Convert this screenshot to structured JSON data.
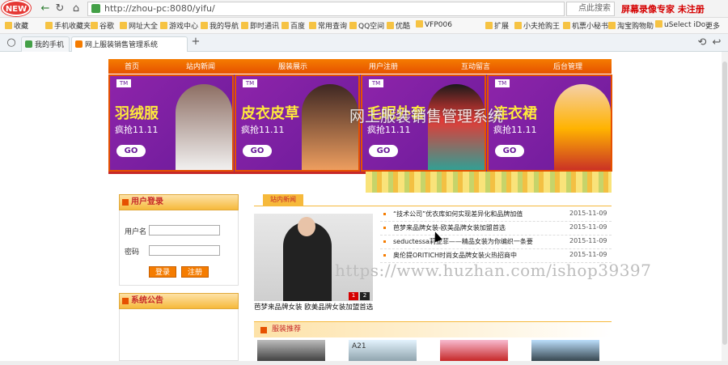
{
  "browser": {
    "badge": "NEW",
    "url": "http://zhou-pc:8080/yifu/",
    "search_placeholder": "点此搜索",
    "recorder_label": "屏幕录像专家 未注册",
    "bookmarks": [
      "收藏",
      "手机收藏夹",
      "谷歌",
      "网址大全",
      "游戏中心",
      "我的导航",
      "即时通讯",
      "百度",
      "常用查询",
      "QQ空间",
      "优酷",
      "VFP006",
      "扩展",
      "小夫抢购王",
      "机票小秘书",
      "淘宝购物助",
      "uSelect iDo",
      "更多"
    ],
    "tabs": [
      {
        "label": "我的手机",
        "color": "#43a047"
      },
      {
        "label": "网上服装销售管理系统",
        "color": "#f57c00"
      }
    ],
    "new_tab": "+"
  },
  "site": {
    "nav": [
      "首页",
      "站内新闻",
      "服装展示",
      "用户注册",
      "互动留言",
      "后台管理"
    ],
    "title": "网上服装销售管理系统",
    "banner_panels": [
      {
        "category": "羽绒服",
        "promo": "疯抢11.11",
        "go": "GO",
        "brand": "TM",
        "accent": "#ffffff"
      },
      {
        "category": "皮衣皮草",
        "promo": "疯抢11.11",
        "go": "GO",
        "brand": "TM",
        "accent": "#f4a261"
      },
      {
        "category": "毛呢外套",
        "promo": "疯抢11.11",
        "go": "GO",
        "brand": "TM",
        "accent": "#e53935"
      },
      {
        "category": "连衣裙",
        "promo": "疯抢11.11",
        "go": "GO",
        "brand": "TM",
        "accent": "#ffb300"
      }
    ],
    "login": {
      "heading": "用户登录",
      "username_label": "用户名",
      "password_label": "密码",
      "login_button": "登录",
      "register_button": "注册"
    },
    "notice": {
      "heading": "系统公告"
    },
    "news": {
      "tab": "站内新闻",
      "caption": "芭梦来品牌女装 欧美品牌女装加盟首选",
      "pager": [
        "1",
        "2"
      ],
      "items": [
        {
          "title": "“技术公司”优衣库如何实现差异化和品牌加值",
          "date": "2015-11-09"
        },
        {
          "title": "芭梦来品牌女装-欧美品牌女装加盟首选",
          "date": "2015-11-09"
        },
        {
          "title": "seductessa莉亚菲——精品女装为你编织一条要",
          "date": "2015-11-09"
        },
        {
          "title": "奥伦提ORITICH时尚女品牌女装火热招商中",
          "date": "2015-11-09"
        }
      ]
    },
    "recommend": {
      "heading": "服装推荐",
      "brand_tag": "A21"
    }
  },
  "watermark": "https://www.huzhan.com/ishop39397"
}
